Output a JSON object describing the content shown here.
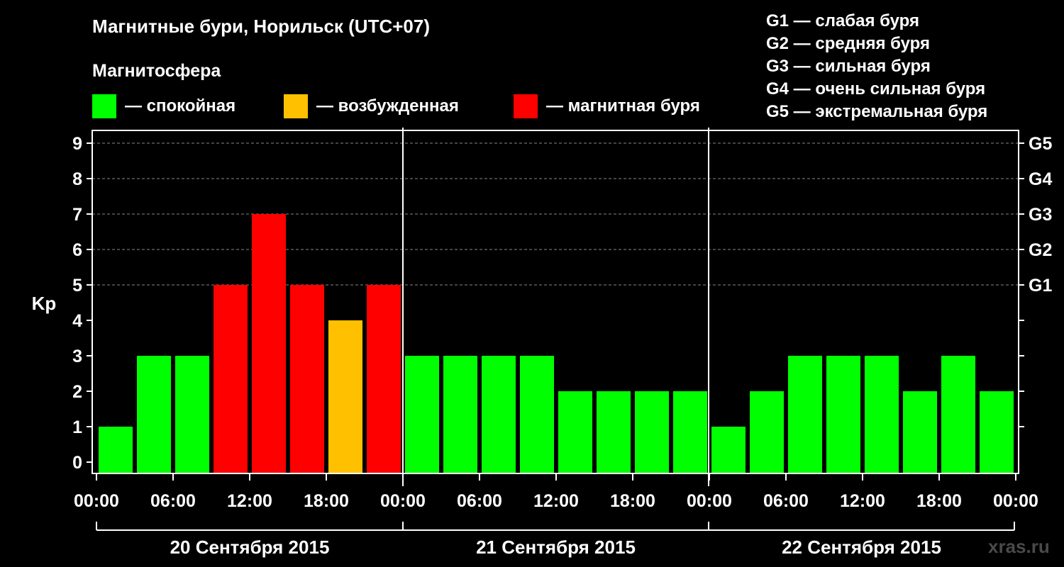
{
  "title": "Магнитные бури, Норильск (UTC+07)",
  "magnetosphere_label": "Магнитосфера",
  "legend": [
    {
      "color": "#00ff00",
      "label": "— спокойная"
    },
    {
      "color": "#ffc000",
      "label": "— возбужденная"
    },
    {
      "color": "#ff0000",
      "label": "— магнитная буря"
    }
  ],
  "storm_scale": [
    "G1 — слабая буря",
    "G2 — средняя буря",
    "G3 — сильная буря",
    "G4 — очень сильная буря",
    "G5 — экстремальная буря"
  ],
  "watermark": "xras.ru",
  "chart_data": {
    "type": "bar",
    "ylabel": "Kp",
    "ylim": [
      0,
      9
    ],
    "yticks": [
      "0",
      "1",
      "2",
      "3",
      "4",
      "5",
      "6",
      "7",
      "8",
      "9"
    ],
    "right_axis_labels": [
      {
        "kp": 5,
        "label": "G1"
      },
      {
        "kp": 6,
        "label": "G2"
      },
      {
        "kp": 7,
        "label": "G3"
      },
      {
        "kp": 8,
        "label": "G4"
      },
      {
        "kp": 9,
        "label": "G5"
      }
    ],
    "xtick_labels": [
      "00:00",
      "06:00",
      "12:00",
      "18:00",
      "00:00",
      "06:00",
      "12:00",
      "18:00",
      "00:00",
      "06:00",
      "12:00",
      "18:00",
      "00:00"
    ],
    "days": [
      "20 Сентября 2015",
      "21 Сентября 2015",
      "22 Сентября 2015"
    ],
    "values": [
      1,
      3,
      3,
      5,
      7,
      5,
      4,
      5,
      3,
      3,
      3,
      3,
      2,
      2,
      2,
      2,
      1,
      2,
      3,
      3,
      3,
      2,
      3,
      2
    ],
    "colors": {
      "quiet": "#00ff00",
      "active": "#ffc000",
      "storm": "#ff0000"
    },
    "grid": true
  }
}
